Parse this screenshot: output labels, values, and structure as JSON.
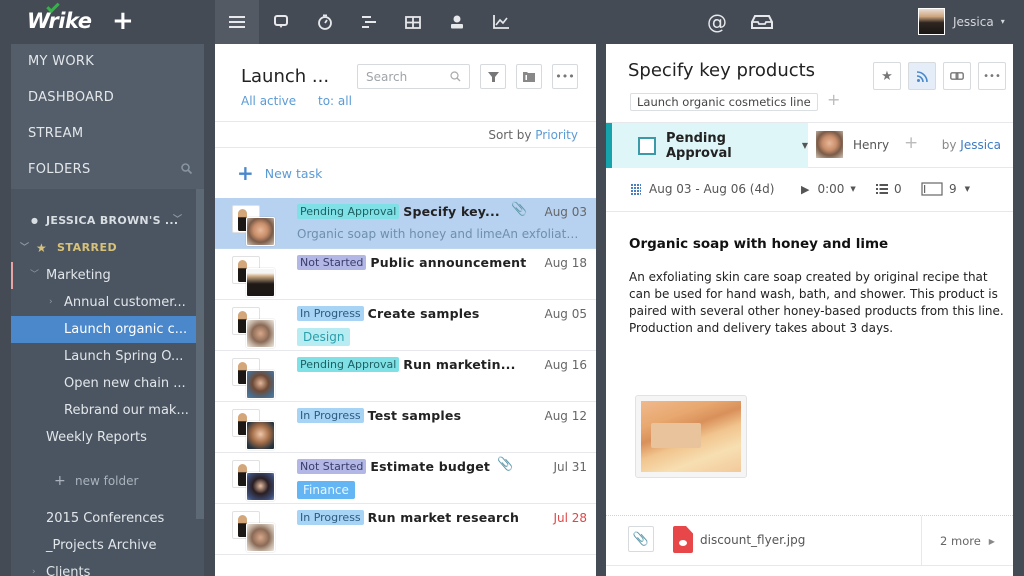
{
  "app": {
    "name": "Wrike"
  },
  "topbar": {
    "add_label": "+",
    "nav_icons": [
      {
        "name": "menu-icon",
        "glyph": "☰",
        "active": true
      },
      {
        "name": "stream-icon",
        "glyph": "🗨"
      },
      {
        "name": "timer-icon",
        "glyph": "⏱"
      },
      {
        "name": "list-icon",
        "glyph": "≡"
      },
      {
        "name": "table-icon",
        "glyph": "⊞"
      },
      {
        "name": "user-icon",
        "glyph": "👤"
      },
      {
        "name": "chart-icon",
        "glyph": "📈"
      }
    ],
    "mentions_icon": "@",
    "inbox_icon": "📥",
    "user_name": "Jessica",
    "user_caret": "▾"
  },
  "sidebar": {
    "top_items": [
      {
        "label": "MY WORK"
      },
      {
        "label": "DASHBOARD"
      },
      {
        "label": "STREAM"
      },
      {
        "label": "FOLDERS"
      }
    ],
    "owner": "JESSICA BROWN'S ...",
    "starred": "STARRED",
    "tree": [
      {
        "label": "Marketing",
        "level": 1,
        "chevron": "v"
      },
      {
        "label": "Annual customer...",
        "level": 2,
        "chevron": ">"
      },
      {
        "label": "Launch organic c...",
        "level": 2,
        "selected": true
      },
      {
        "label": "Launch Spring O...",
        "level": 2
      },
      {
        "label": "Open new chain ...",
        "level": 2
      },
      {
        "label": "Rebrand our mak...",
        "level": 2
      },
      {
        "label": "Weekly Reports",
        "level": 1
      }
    ],
    "new_folder": "new folder",
    "bottom_items": [
      {
        "label": "2015 Conferences"
      },
      {
        "label": "_Projects Archive"
      },
      {
        "label": "Clients",
        "chevron": ">"
      }
    ]
  },
  "tasklist": {
    "title": "Launch ...",
    "filter_status": "All active",
    "filter_assignee": "to: all",
    "search_placeholder": "Search",
    "sort_prefix": "Sort by ",
    "sort_value": "Priority",
    "new_task": "New task",
    "tasks": [
      {
        "status": "Pending Approval",
        "status_type": "pending",
        "title": "Specify key...",
        "date": "Aug 03",
        "attachment": true,
        "desc": "Organic soap with honey and limeAn exfoliating skin care soap",
        "selected": true,
        "avatar": "henry"
      },
      {
        "status": "Not Started",
        "status_type": "notstarted",
        "title": "Public announcement",
        "date": "Aug 18",
        "avatar": "jess"
      },
      {
        "status": "In Progress",
        "status_type": "progress",
        "title": "Create samples",
        "date": "Aug 05",
        "tag": "Design",
        "tag_type": "design",
        "avatar": "man2"
      },
      {
        "status": "Pending Approval",
        "status_type": "pending",
        "title": "Run marketin...",
        "date": "Aug 16",
        "avatar": "woman1"
      },
      {
        "status": "In Progress",
        "status_type": "progress",
        "title": "Test samples",
        "date": "Aug 12",
        "avatar": "woman2"
      },
      {
        "status": "Not Started",
        "status_type": "notstarted",
        "title": "Estimate budget",
        "date": "Jul 31",
        "attachment": true,
        "tag": "Finance",
        "tag_type": "finance",
        "avatar": "woman3"
      },
      {
        "status": "In Progress",
        "status_type": "progress",
        "title": "Run market research",
        "date": "Jul 28",
        "overdue": true,
        "avatar": "man2"
      }
    ]
  },
  "detail": {
    "title": "Specify key products",
    "folder_tag": "Launch organic cosmetics line",
    "status": "Pending Approval",
    "assignee": "Henry",
    "author_prefix": "by ",
    "author": "Jessica",
    "dates": "Aug 03 - Aug 06 (4d)",
    "time_tracked": "0:00",
    "subtasks": "0",
    "priority_count": "9",
    "body_heading": "Organic soap with honey and lime",
    "body_text": "An exfoliating skin care soap created by original recipe that can be used for hand wash, bath, and shower. This product is paired with several other honey-based products from this line. Production and delivery takes about 3 days.",
    "attachment_name": "discount_flyer.jpg",
    "more_attachments": "2 more"
  },
  "colors": {
    "topbar_bg": "#454b55",
    "sidebar_selected": "#4a88cb",
    "link": "#5b9bd5",
    "status_pending": "#7fe0e6",
    "status_not_started": "#b3b7e6",
    "status_in_progress": "#a7d3f5",
    "overdue": "#e04646",
    "starred": "#d8c27a"
  }
}
